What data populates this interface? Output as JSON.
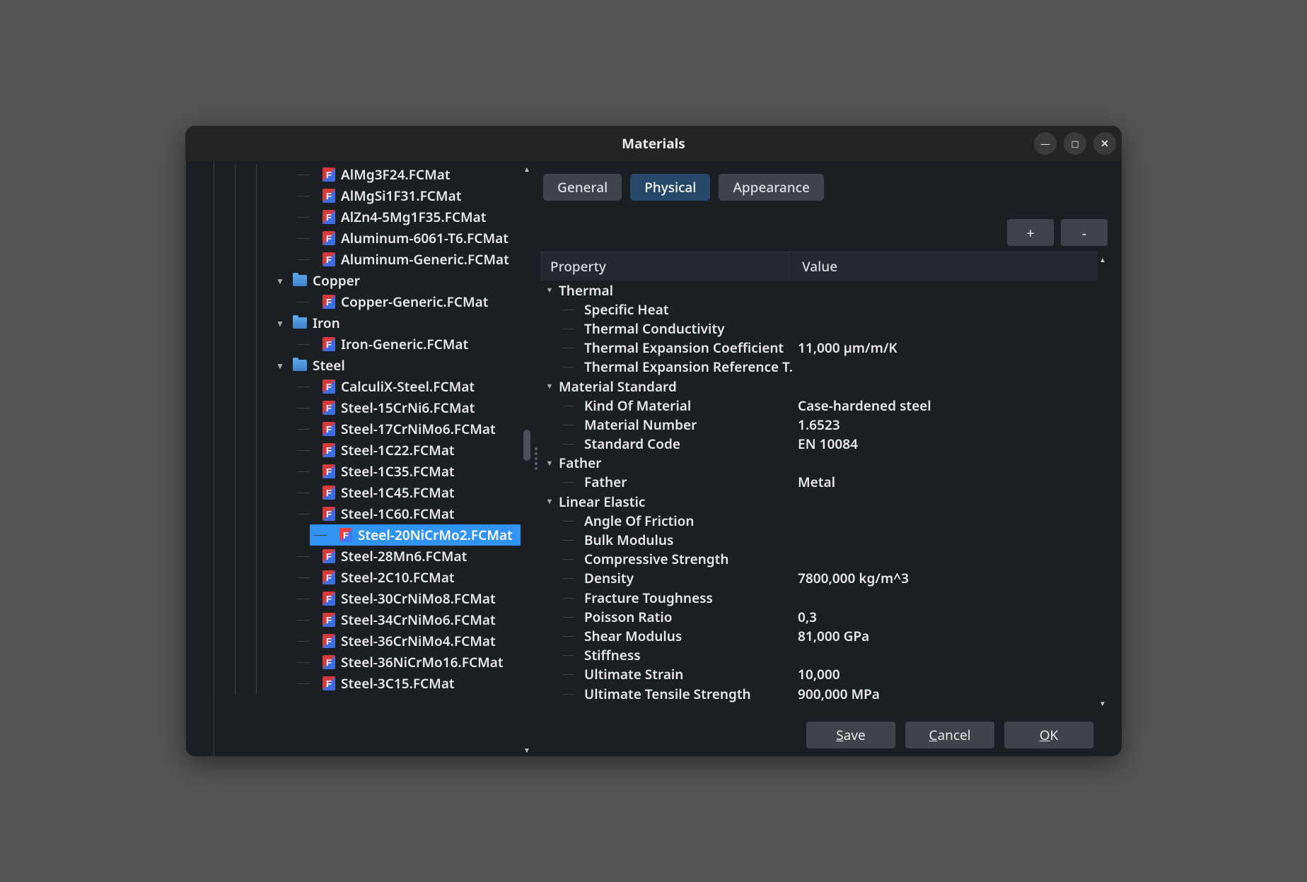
{
  "window": {
    "title": "Materials"
  },
  "tabs": {
    "general": "General",
    "physical": "Physical",
    "appearance": "Appearance",
    "active": "physical"
  },
  "buttons": {
    "plus": "+",
    "minus": "-",
    "save": "Save",
    "cancel": "Cancel",
    "ok": "OK"
  },
  "columns": {
    "property": "Property",
    "value": "Value"
  },
  "tree": {
    "rootFiles": [
      "AlMg3F24.FCMat",
      "AlMgSi1F31.FCMat",
      "AlZn4-5Mg1F35.FCMat",
      "Aluminum-6061-T6.FCMat",
      "Aluminum-Generic.FCMat"
    ],
    "folders": [
      {
        "name": "Copper",
        "files": [
          "Copper-Generic.FCMat"
        ]
      },
      {
        "name": "Iron",
        "files": [
          "Iron-Generic.FCMat"
        ]
      },
      {
        "name": "Steel",
        "files": [
          "CalculiX-Steel.FCMat",
          "Steel-15CrNi6.FCMat",
          "Steel-17CrNiMo6.FCMat",
          "Steel-1C22.FCMat",
          "Steel-1C35.FCMat",
          "Steel-1C45.FCMat",
          "Steel-1C60.FCMat",
          "Steel-20NiCrMo2.FCMat",
          "Steel-28Mn6.FCMat",
          "Steel-2C10.FCMat",
          "Steel-30CrNiMo8.FCMat",
          "Steel-34CrNiMo6.FCMat",
          "Steel-36CrNiMo4.FCMat",
          "Steel-36NiCrMo16.FCMat",
          "Steel-3C15.FCMat"
        ]
      }
    ],
    "selected": "Steel-20NiCrMo2.FCMat"
  },
  "props": [
    {
      "group": "Thermal",
      "rows": [
        {
          "p": "Specific Heat",
          "v": ""
        },
        {
          "p": "Thermal Conductivity",
          "v": ""
        },
        {
          "p": "Thermal Expansion Coefficient",
          "v": "11,000 µm/m/K"
        },
        {
          "p": "Thermal Expansion Reference T...",
          "v": ""
        }
      ]
    },
    {
      "group": "Material Standard",
      "rows": [
        {
          "p": "Kind Of Material",
          "v": "Case-hardened steel"
        },
        {
          "p": "Material Number",
          "v": "1.6523"
        },
        {
          "p": "Standard Code",
          "v": "EN 10084"
        }
      ]
    },
    {
      "group": "Father",
      "rows": [
        {
          "p": "Father",
          "v": "Metal"
        }
      ]
    },
    {
      "group": "Linear Elastic",
      "rows": [
        {
          "p": "Angle Of Friction",
          "v": ""
        },
        {
          "p": "Bulk Modulus",
          "v": ""
        },
        {
          "p": "Compressive Strength",
          "v": ""
        },
        {
          "p": "Density",
          "v": "7800,000 kg/m^3"
        },
        {
          "p": "Fracture Toughness",
          "v": ""
        },
        {
          "p": "Poisson Ratio",
          "v": " 0,3"
        },
        {
          "p": "Shear Modulus",
          "v": "81,000 GPa"
        },
        {
          "p": "Stiffness",
          "v": ""
        },
        {
          "p": "Ultimate Strain",
          "v": "10,000"
        },
        {
          "p": "Ultimate Tensile Strength",
          "v": "900,000 MPa"
        }
      ]
    }
  ]
}
